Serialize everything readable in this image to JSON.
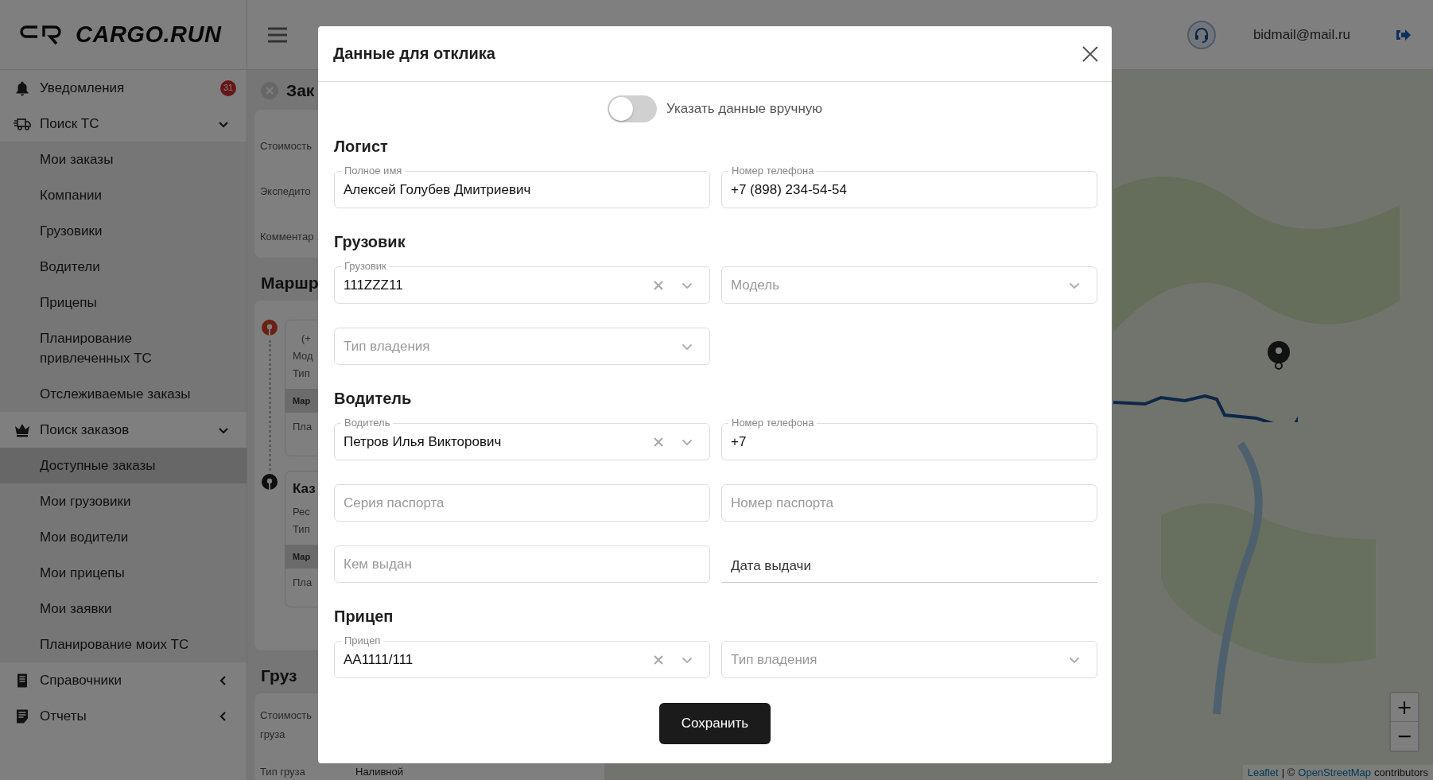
{
  "header": {
    "logo": "CARGO.RUN",
    "user_email": "bidmail@mail.ru"
  },
  "sidebar": {
    "items": [
      {
        "label": "Уведомления",
        "badge": "31",
        "selected": false
      },
      {
        "label": "Поиск ТС",
        "expanded": true,
        "selected": false,
        "children": [
          {
            "label": "Мои заказы",
            "selected": false
          },
          {
            "label": "Компании",
            "selected": false
          },
          {
            "label": "Грузовики",
            "selected": false
          },
          {
            "label": "Водители",
            "selected": false
          },
          {
            "label": "Прицепы",
            "selected": false
          },
          {
            "label": "Планирование привлеченных ТС",
            "selected": false
          },
          {
            "label": "Отслеживаемые заказы",
            "selected": false
          }
        ]
      },
      {
        "label": "Поиск заказов",
        "expanded": true,
        "selected": false,
        "children": [
          {
            "label": "Доступные заказы",
            "selected": true
          },
          {
            "label": "Мои грузовики",
            "selected": false
          },
          {
            "label": "Мои водители",
            "selected": false
          },
          {
            "label": "Мои прицепы",
            "selected": false
          },
          {
            "label": "Мои заявки",
            "selected": false
          },
          {
            "label": "Планирование моих ТС",
            "selected": false
          }
        ]
      },
      {
        "label": "Справочники",
        "expanded": false,
        "selected": false
      },
      {
        "label": "Отчеты",
        "expanded": false,
        "selected": false
      }
    ]
  },
  "order": {
    "title": "Зак",
    "details": [
      "Стоимость",
      "Экспедито",
      "Комментар"
    ],
    "route_title": "Маршр",
    "stops": [
      {
        "kind": "origin",
        "lines": [
          "(+",
          "Мод",
          "Тип"
        ],
        "tag": "Мар",
        "footer": "Пла"
      },
      {
        "kind": "destination",
        "title": "Каз",
        "lines": [
          "Рес",
          "Тип"
        ],
        "tag": "Мар",
        "footer": "Пла"
      }
    ],
    "cargo_title": "Груз",
    "cargo": [
      {
        "label": "Стоимость груза"
      },
      {
        "label": "Тип груза",
        "value": "Наливной"
      }
    ]
  },
  "map": {
    "zoom_in": "+",
    "zoom_out": "−",
    "attribution": [
      {
        "text": "Leaflet",
        "link": true
      },
      {
        "text": "| ©",
        "link": false
      },
      {
        "text": "OpenStreetMap",
        "link": true
      },
      {
        "text": "contributors",
        "link": false
      }
    ]
  },
  "modal": {
    "title": "Данные для отклика",
    "manual_toggle": {
      "label": "Указать данные вручную",
      "on": false
    },
    "sections": [
      {
        "title": "Логист",
        "fields": [
          {
            "kind": "text",
            "label": "Полное имя",
            "value": "Алексей Голубев Дмитриевич"
          },
          {
            "kind": "text",
            "label": "Номер телефона",
            "value": "+7 (898) 234-54-54"
          }
        ]
      },
      {
        "title": "Грузовик",
        "fields": [
          {
            "kind": "select",
            "label": "Грузовик",
            "value": "111ZZZ11",
            "clearable": true
          },
          {
            "kind": "select",
            "placeholder": "Модель"
          },
          {
            "kind": "select",
            "placeholder": "Тип владения"
          }
        ]
      },
      {
        "title": "Водитель",
        "fields": [
          {
            "kind": "select",
            "label": "Водитель",
            "value": "Петров Илья Викторович",
            "clearable": true
          },
          {
            "kind": "text",
            "label": "Номер телефона",
            "value": "+7"
          },
          {
            "kind": "text",
            "placeholder": "Серия паспорта"
          },
          {
            "kind": "text",
            "placeholder": "Номер паспорта"
          },
          {
            "kind": "text",
            "placeholder": "Кем выдан"
          },
          {
            "kind": "date",
            "label": "Дата выдачи"
          }
        ]
      },
      {
        "title": "Прицеп",
        "fields": [
          {
            "kind": "select",
            "label": "Прицеп",
            "value": "АА1111/111",
            "clearable": true
          },
          {
            "kind": "select",
            "placeholder": "Тип владения"
          }
        ]
      }
    ],
    "save_button": "Сохранить"
  }
}
